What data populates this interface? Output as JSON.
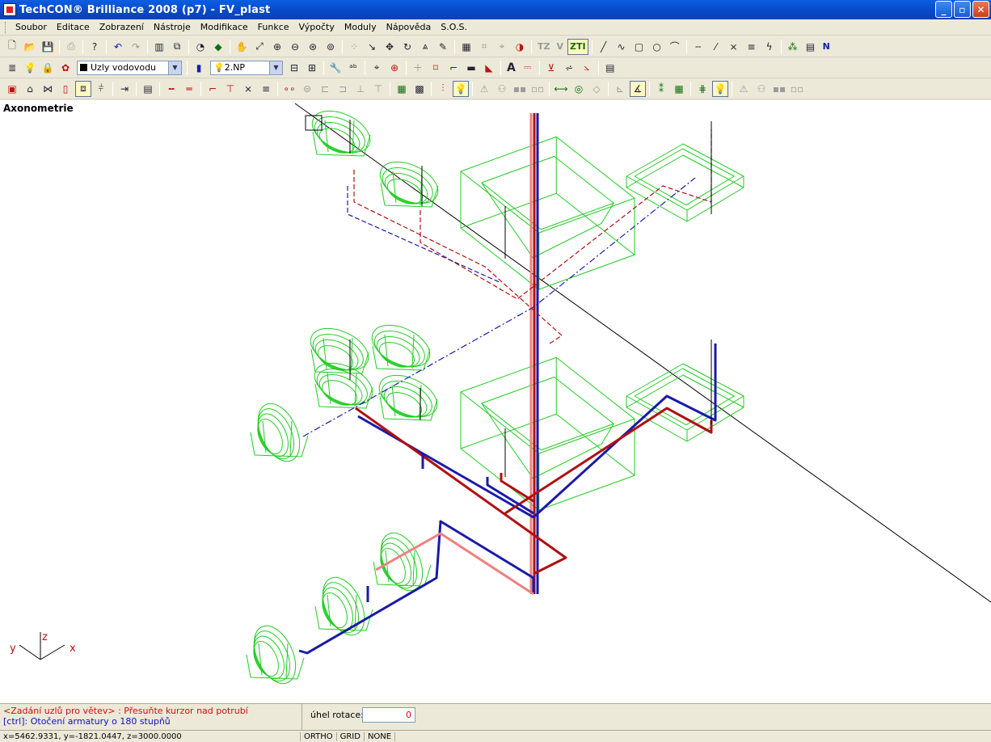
{
  "window": {
    "title": "TechCON® Brilliance 2008  (p7) - FV_plast",
    "btn_min": "_",
    "btn_max": "▫",
    "btn_close": "✕"
  },
  "menu": [
    "Soubor",
    "Editace",
    "Zobrazení",
    "Nástroje",
    "Modifikace",
    "Funkce",
    "Výpočty",
    "Moduly",
    "Nápověda",
    "S.O.S."
  ],
  "toolbar1": {
    "tz_label": "TZ",
    "v_label": "V",
    "zti_label": "ZTI",
    "n_label": "N"
  },
  "toolbar2": {
    "layer_value": "Uzly vodovodu",
    "floor_value": "2.NP",
    "a_label": "A"
  },
  "view": {
    "label": "Axonometrie"
  },
  "axes": {
    "y": "y",
    "z": "z",
    "x": "x"
  },
  "command": {
    "line1": "<Zadání uzlů pro větev> : Přesuňte kurzor nad potrubí",
    "line2": "[ctrl]: Otočení armatury o 180 stupňů",
    "rotation_label": "úhel rotace:",
    "rotation_value": "0"
  },
  "status": {
    "coords": "x=5462.9331, y=-1821.0447, z=3000.0000",
    "modes": [
      "ORTHO",
      "GRID",
      "NONE"
    ]
  },
  "colors": {
    "fixture": "#22cc22",
    "cold_water": "#1a1aa8",
    "hot_water": "#b01010",
    "hot_return": "#f08080",
    "axis_line": "#000000"
  }
}
